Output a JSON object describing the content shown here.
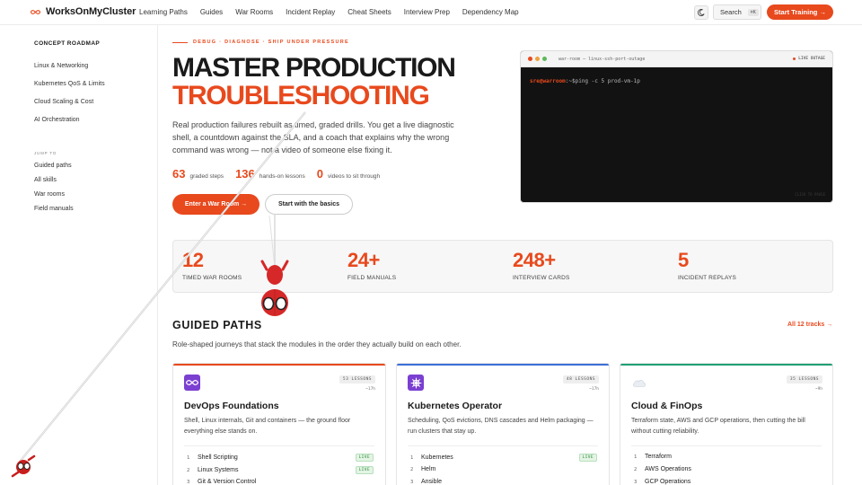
{
  "brand": {
    "name": "WorksOnMyCluster",
    "accent": "#e8491d"
  },
  "nav": {
    "items": [
      "Learning Paths",
      "Guides",
      "War Rooms",
      "Incident Replay",
      "Cheat Sheets",
      "Interview Prep",
      "Dependency Map"
    ],
    "theme_icon": "moon-icon",
    "search_label": "Search",
    "search_kbd": "⌘K",
    "cta_label": "Start Training →"
  },
  "sidebar": {
    "title": "CONCEPT ROADMAP",
    "roadmap": [
      "Linux & Networking",
      "Kubernetes QoS & Limits",
      "Cloud Scaling & Cost",
      "AI Orchestration"
    ],
    "jump_label": "JUMP TO",
    "jump": [
      "Guided paths",
      "All skills",
      "War rooms",
      "Field manuals"
    ]
  },
  "hero": {
    "eyebrow": "DEBUG · DIAGNOSE · SHIP UNDER PRESSURE",
    "title_line1": "MASTER PRODUCTION",
    "title_line2": "TROUBLESHOOTING",
    "description": "Real production failures rebuilt as timed, graded drills. You get a live diagnostic shell, a countdown against the SLA, and a coach that explains why the wrong command was wrong — not a video of someone else fixing it.",
    "stats": [
      {
        "num": "63",
        "label": "graded steps"
      },
      {
        "num": "136",
        "label": "hands-on lessons"
      },
      {
        "num": "0",
        "label": "videos to sit through"
      }
    ],
    "primary_btn": "Enter a War Room →",
    "secondary_btn": "Start with the basics"
  },
  "terminal": {
    "title": "war-room — linux-ssh-port-outage",
    "live_label": "LIVE OUTAGE",
    "prompt": "sre@warroom",
    "path": ":~$",
    "command": "ping -c 5 prod-vm-1p",
    "hint": "CLICK TO PAUSE"
  },
  "stats_band": [
    {
      "num": "12",
      "label": "TIMED WAR ROOMS"
    },
    {
      "num": "24+",
      "label": "FIELD MANUALS"
    },
    {
      "num": "248+",
      "label": "INTERVIEW CARDS"
    },
    {
      "num": "5",
      "label": "INCIDENT REPLAYS"
    }
  ],
  "guided": {
    "title": "GUIDED PATHS",
    "link": "All 12 tracks →",
    "subtitle": "Role-shaped journeys that stack the modules in the order they actually build on each other.",
    "cards": [
      {
        "icon": "infinity-icon",
        "color": "#e8491d",
        "badge": "53 LESSONS",
        "duration": "~17h",
        "title": "DevOps Foundations",
        "desc": "Shell, Linux internals, Git and containers — the ground floor everything else stands on.",
        "modules": [
          {
            "idx": "1",
            "name": "Shell Scripting",
            "status": "LIVE"
          },
          {
            "idx": "2",
            "name": "Linux Systems",
            "status": "LIVE"
          },
          {
            "idx": "3",
            "name": "Git & Version Control",
            "status": ""
          }
        ]
      },
      {
        "icon": "helm-wheel-icon",
        "color": "#3b6fd8",
        "badge": "48 LESSONS",
        "duration": "~17h",
        "title": "Kubernetes Operator",
        "desc": "Scheduling, QoS evictions, DNS cascades and Helm packaging — run clusters that stay up.",
        "modules": [
          {
            "idx": "1",
            "name": "Kubernetes",
            "status": "LIVE"
          },
          {
            "idx": "2",
            "name": "Helm",
            "status": ""
          },
          {
            "idx": "3",
            "name": "Ansible",
            "status": ""
          }
        ]
      },
      {
        "icon": "cloud-icon",
        "color": "#1f9e74",
        "badge": "35 LESSONS",
        "duration": "~9h",
        "title": "Cloud & FinOps",
        "desc": "Terraform state, AWS and GCP operations, then cutting the bill without cutting reliability.",
        "modules": [
          {
            "idx": "1",
            "name": "Terraform",
            "status": ""
          },
          {
            "idx": "2",
            "name": "AWS Operations",
            "status": ""
          },
          {
            "idx": "3",
            "name": "GCP Operations",
            "status": ""
          }
        ]
      }
    ]
  }
}
